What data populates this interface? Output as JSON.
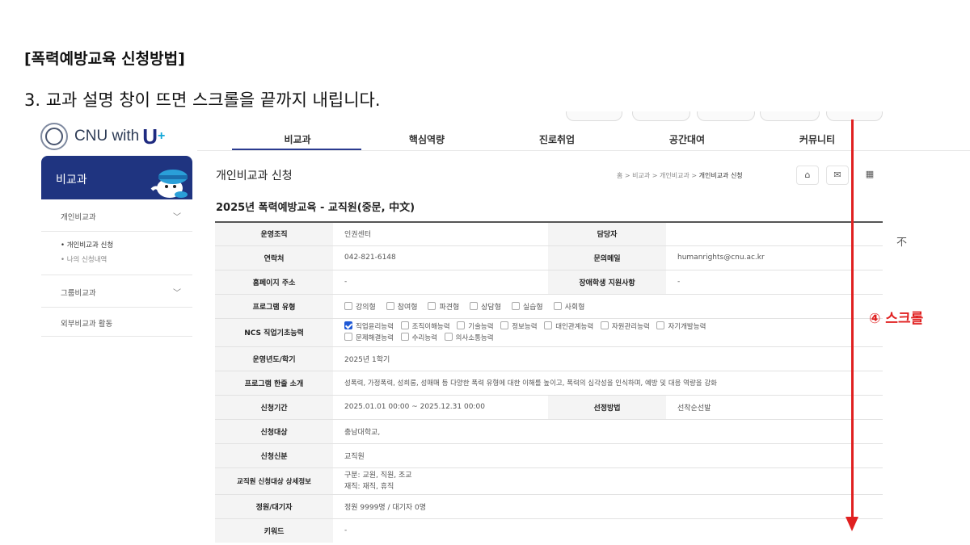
{
  "doc": {
    "title": "[폭력예방교육 신청방법]",
    "step": "3. 교과 설명 창이 뜨면 스크롤을 끝까지 내립니다."
  },
  "logo": {
    "brand": "CNU with",
    "u": "U",
    "plus": "+"
  },
  "nav": {
    "items": [
      "비교과",
      "핵심역량",
      "진로취업",
      "공간대여",
      "커뮤니티"
    ]
  },
  "sidebar": {
    "header": "비교과",
    "menu1": "개인비교과",
    "sub1": "• 개인비교과 신청",
    "sub2": "• 나의 신청내역",
    "menu2": "그룹비교과",
    "menu3": "외부비교과 활동"
  },
  "page": {
    "title": "개인비교과 신청",
    "breadcrumb": "홈  >  비교과  >  개인비교과  >  ",
    "breadcrumb_current": "개인비교과 신청",
    "course_title": "2025년 폭력예방교육 - 교직원(중문, 中文)"
  },
  "info": {
    "org_label": "운영조직",
    "org": "인권센터",
    "manager_label": "담당자",
    "manager": "",
    "contact_label": "연락처",
    "contact": "042-821-6148",
    "email_label": "문의메일",
    "email": "humanrights@cnu.ac.kr",
    "homepage_label": "홈페이지 주소",
    "homepage": "-",
    "disability_label": "장애학생 지원사항",
    "disability": "-",
    "type_label": "프로그램 유형",
    "types": [
      "강의형",
      "참여형",
      "파견형",
      "상담형",
      "실습형",
      "사회형"
    ],
    "ncs_label": "NCS 직업기초능력",
    "ncs_row1": [
      "직업윤리능력",
      "조직이해능력",
      "기술능력",
      "정보능력",
      "대인관계능력",
      "자원관리능력",
      "자기개발능력"
    ],
    "ncs_row2": [
      "문제해결능력",
      "수리능력",
      "의사소통능력"
    ],
    "year_label": "운영년도/학기",
    "year": "2025년 1학기",
    "intro_label": "프로그램 한줄 소개",
    "intro": "성폭력, 가정폭력, 성희롱, 성매매 등 다양한 폭력 유형에 대한 이해를 높이고, 폭력의 심각성을 인식하며, 예방 및 대응 역량을 강화",
    "period_label": "신청기간",
    "period": "2025.01.01 00:00 ~ 2025.12.31 00:00",
    "selection_label": "선정방법",
    "selection": "선착순선발",
    "target_label": "신청대상",
    "target": "충남대학교,",
    "status_label": "신청신분",
    "status": "교직원",
    "staff_label": "교직원 신청대상 상세정보",
    "staff_line1": "구분: 교원, 직원, 조교",
    "staff_line2": "재직: 재직, 휴직",
    "capacity_label": "정원/대기자",
    "capacity": "정원 9999명 / 대기자 0명",
    "keyword_label": "키워드",
    "keyword": "-"
  },
  "to_top": "不",
  "annotation": {
    "scroll": "④ 스크롤",
    "color": "#e02020"
  },
  "colors": {
    "brand_navy": "#1f3480",
    "checkbox_on": "#1f59d6"
  }
}
